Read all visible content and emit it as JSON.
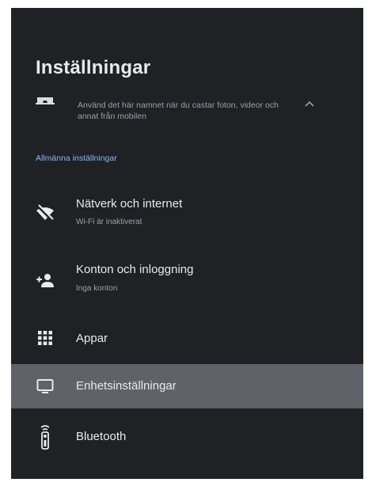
{
  "screen": {
    "title": "Inställningar"
  },
  "cast_info": {
    "icon": "cast-icon",
    "description": "Använd det här namnet när du castar foton, videor och annat från mobilen",
    "collapse_icon": "chevron-up-icon"
  },
  "section": {
    "header": "Allmänna inställningar"
  },
  "menu": {
    "items": [
      {
        "icon": "wifi-off-icon",
        "label": "Nätverk och internet",
        "sub": "Wi-Fi är inaktiverat"
      },
      {
        "icon": "add-person-icon",
        "label": "Konton och inloggning",
        "sub": "Inga konton"
      },
      {
        "icon": "apps-grid-icon",
        "label": "Appar"
      },
      {
        "icon": "tv-icon",
        "label": "Enhetsinställningar",
        "selected": true
      },
      {
        "icon": "remote-icon",
        "label": "Bluetooth"
      }
    ]
  },
  "colors": {
    "background": "#202124",
    "selected": "#5f6368",
    "accent": "#8ab4f8",
    "primary_text": "#e8eaed",
    "secondary_text": "#9aa0a6"
  }
}
